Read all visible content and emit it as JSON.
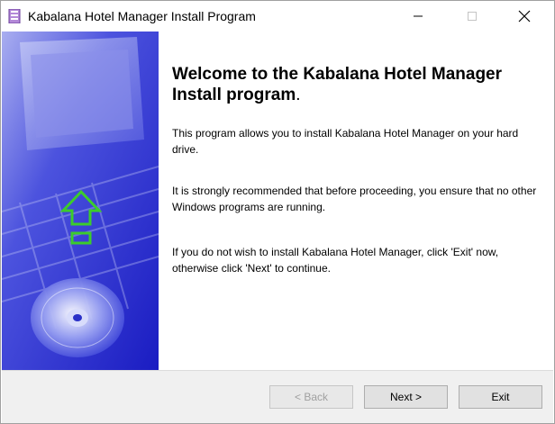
{
  "window": {
    "title": "Kabalana Hotel Manager Install Program"
  },
  "icons": {
    "app": "app-icon",
    "minimize": "minimize-icon",
    "maximize": "maximize-icon",
    "close": "close-icon",
    "banner_arrow": "up-arrow-icon",
    "banner_disc": "cd-disc-icon"
  },
  "content": {
    "heading_main": "Welcome to the Kabalana Hotel Manager Install program",
    "heading_period": ".",
    "paragraph1": "This program allows you to install Kabalana Hotel Manager on your hard drive.",
    "paragraph2": "It is strongly recommended that before proceeding, you ensure that no other Windows programs are running.",
    "paragraph3": "If you do not wish to install Kabalana Hotel Manager, click 'Exit' now, otherwise click 'Next' to continue."
  },
  "buttons": {
    "back": "< Back",
    "next": "Next >",
    "exit": "Exit"
  },
  "colors": {
    "banner_blue": "#1f22c8",
    "banner_light": "#9fa8f0",
    "arrow_green": "#3ccc2c"
  }
}
